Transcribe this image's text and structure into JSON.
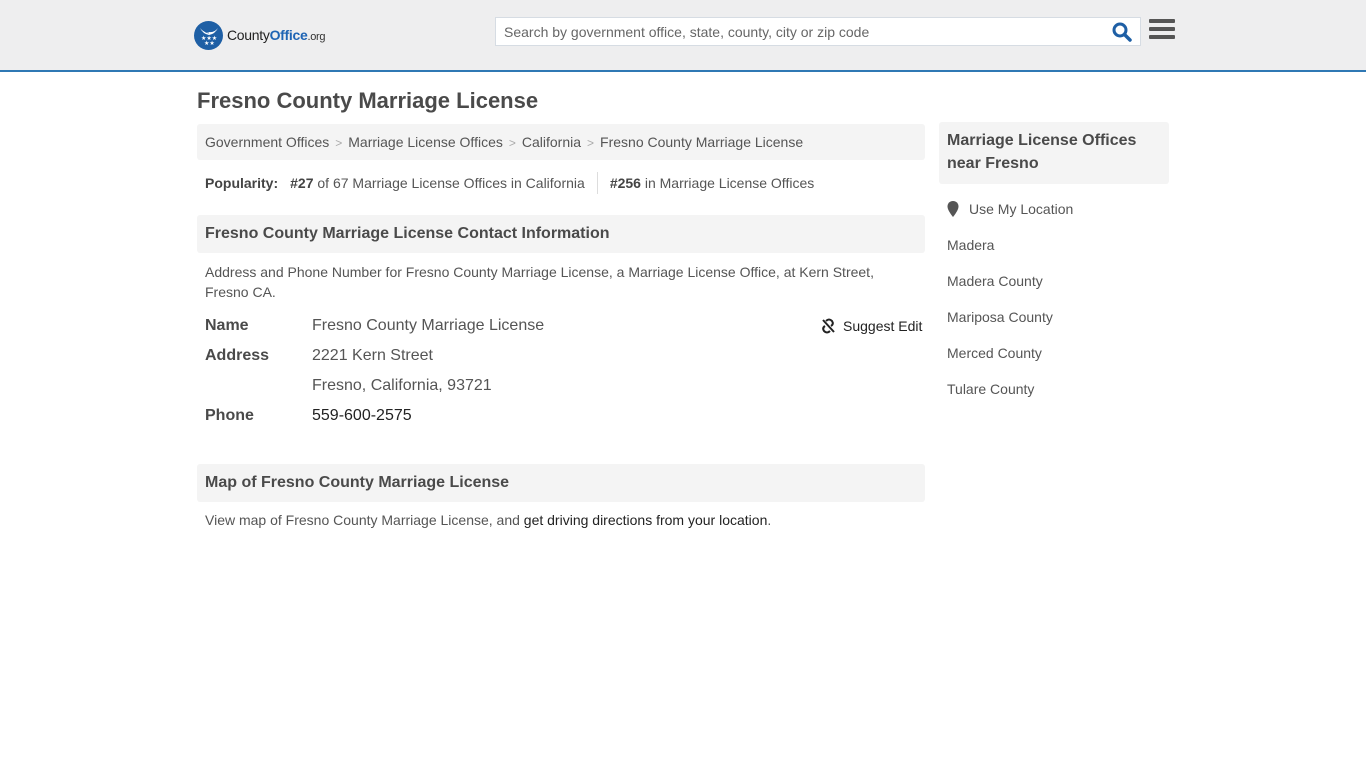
{
  "header": {
    "logo": {
      "name_part1": "County",
      "name_part2": "Office",
      "tld": ".org"
    },
    "search": {
      "placeholder": "Search by government office, state, county, city or zip code",
      "value": ""
    },
    "brand_color": "#1e64b4",
    "accent_line_color": "#2f78b4"
  },
  "page_title": "Fresno County Marriage License",
  "breadcrumb": [
    {
      "label": "Government Offices"
    },
    {
      "label": "Marriage License Offices"
    },
    {
      "label": "California"
    },
    {
      "label": "Fresno County Marriage License"
    }
  ],
  "breadcrumb_separator": ">",
  "popularity": {
    "label": "Popularity:",
    "state_rank": "#27",
    "state_text": "of 67 Marriage License Offices in California",
    "national_rank": "#256",
    "national_text": "in Marriage License Offices"
  },
  "contact": {
    "heading": "Fresno County Marriage License Contact Information",
    "description": "Address and Phone Number for Fresno County Marriage License, a Marriage License Office, at Kern Street, Fresno CA.",
    "suggest_edit": "Suggest Edit",
    "fields": {
      "name_label": "Name",
      "name_value": "Fresno County Marriage License",
      "address_label": "Address",
      "address_line1": "2221 Kern Street",
      "address_line2": "Fresno, California, 93721",
      "phone_label": "Phone",
      "phone_value": "559-600-2575"
    }
  },
  "map": {
    "heading": "Map of Fresno County Marriage License",
    "text_before": "View map of Fresno County Marriage License, and ",
    "link": "get driving directions from your location",
    "text_after": "."
  },
  "sidebar": {
    "heading": "Marriage License Offices near Fresno",
    "use_location": "Use My Location",
    "links": [
      {
        "label": "Madera"
      },
      {
        "label": "Madera County"
      },
      {
        "label": "Mariposa County"
      },
      {
        "label": "Merced County"
      },
      {
        "label": "Tulare County"
      }
    ]
  }
}
